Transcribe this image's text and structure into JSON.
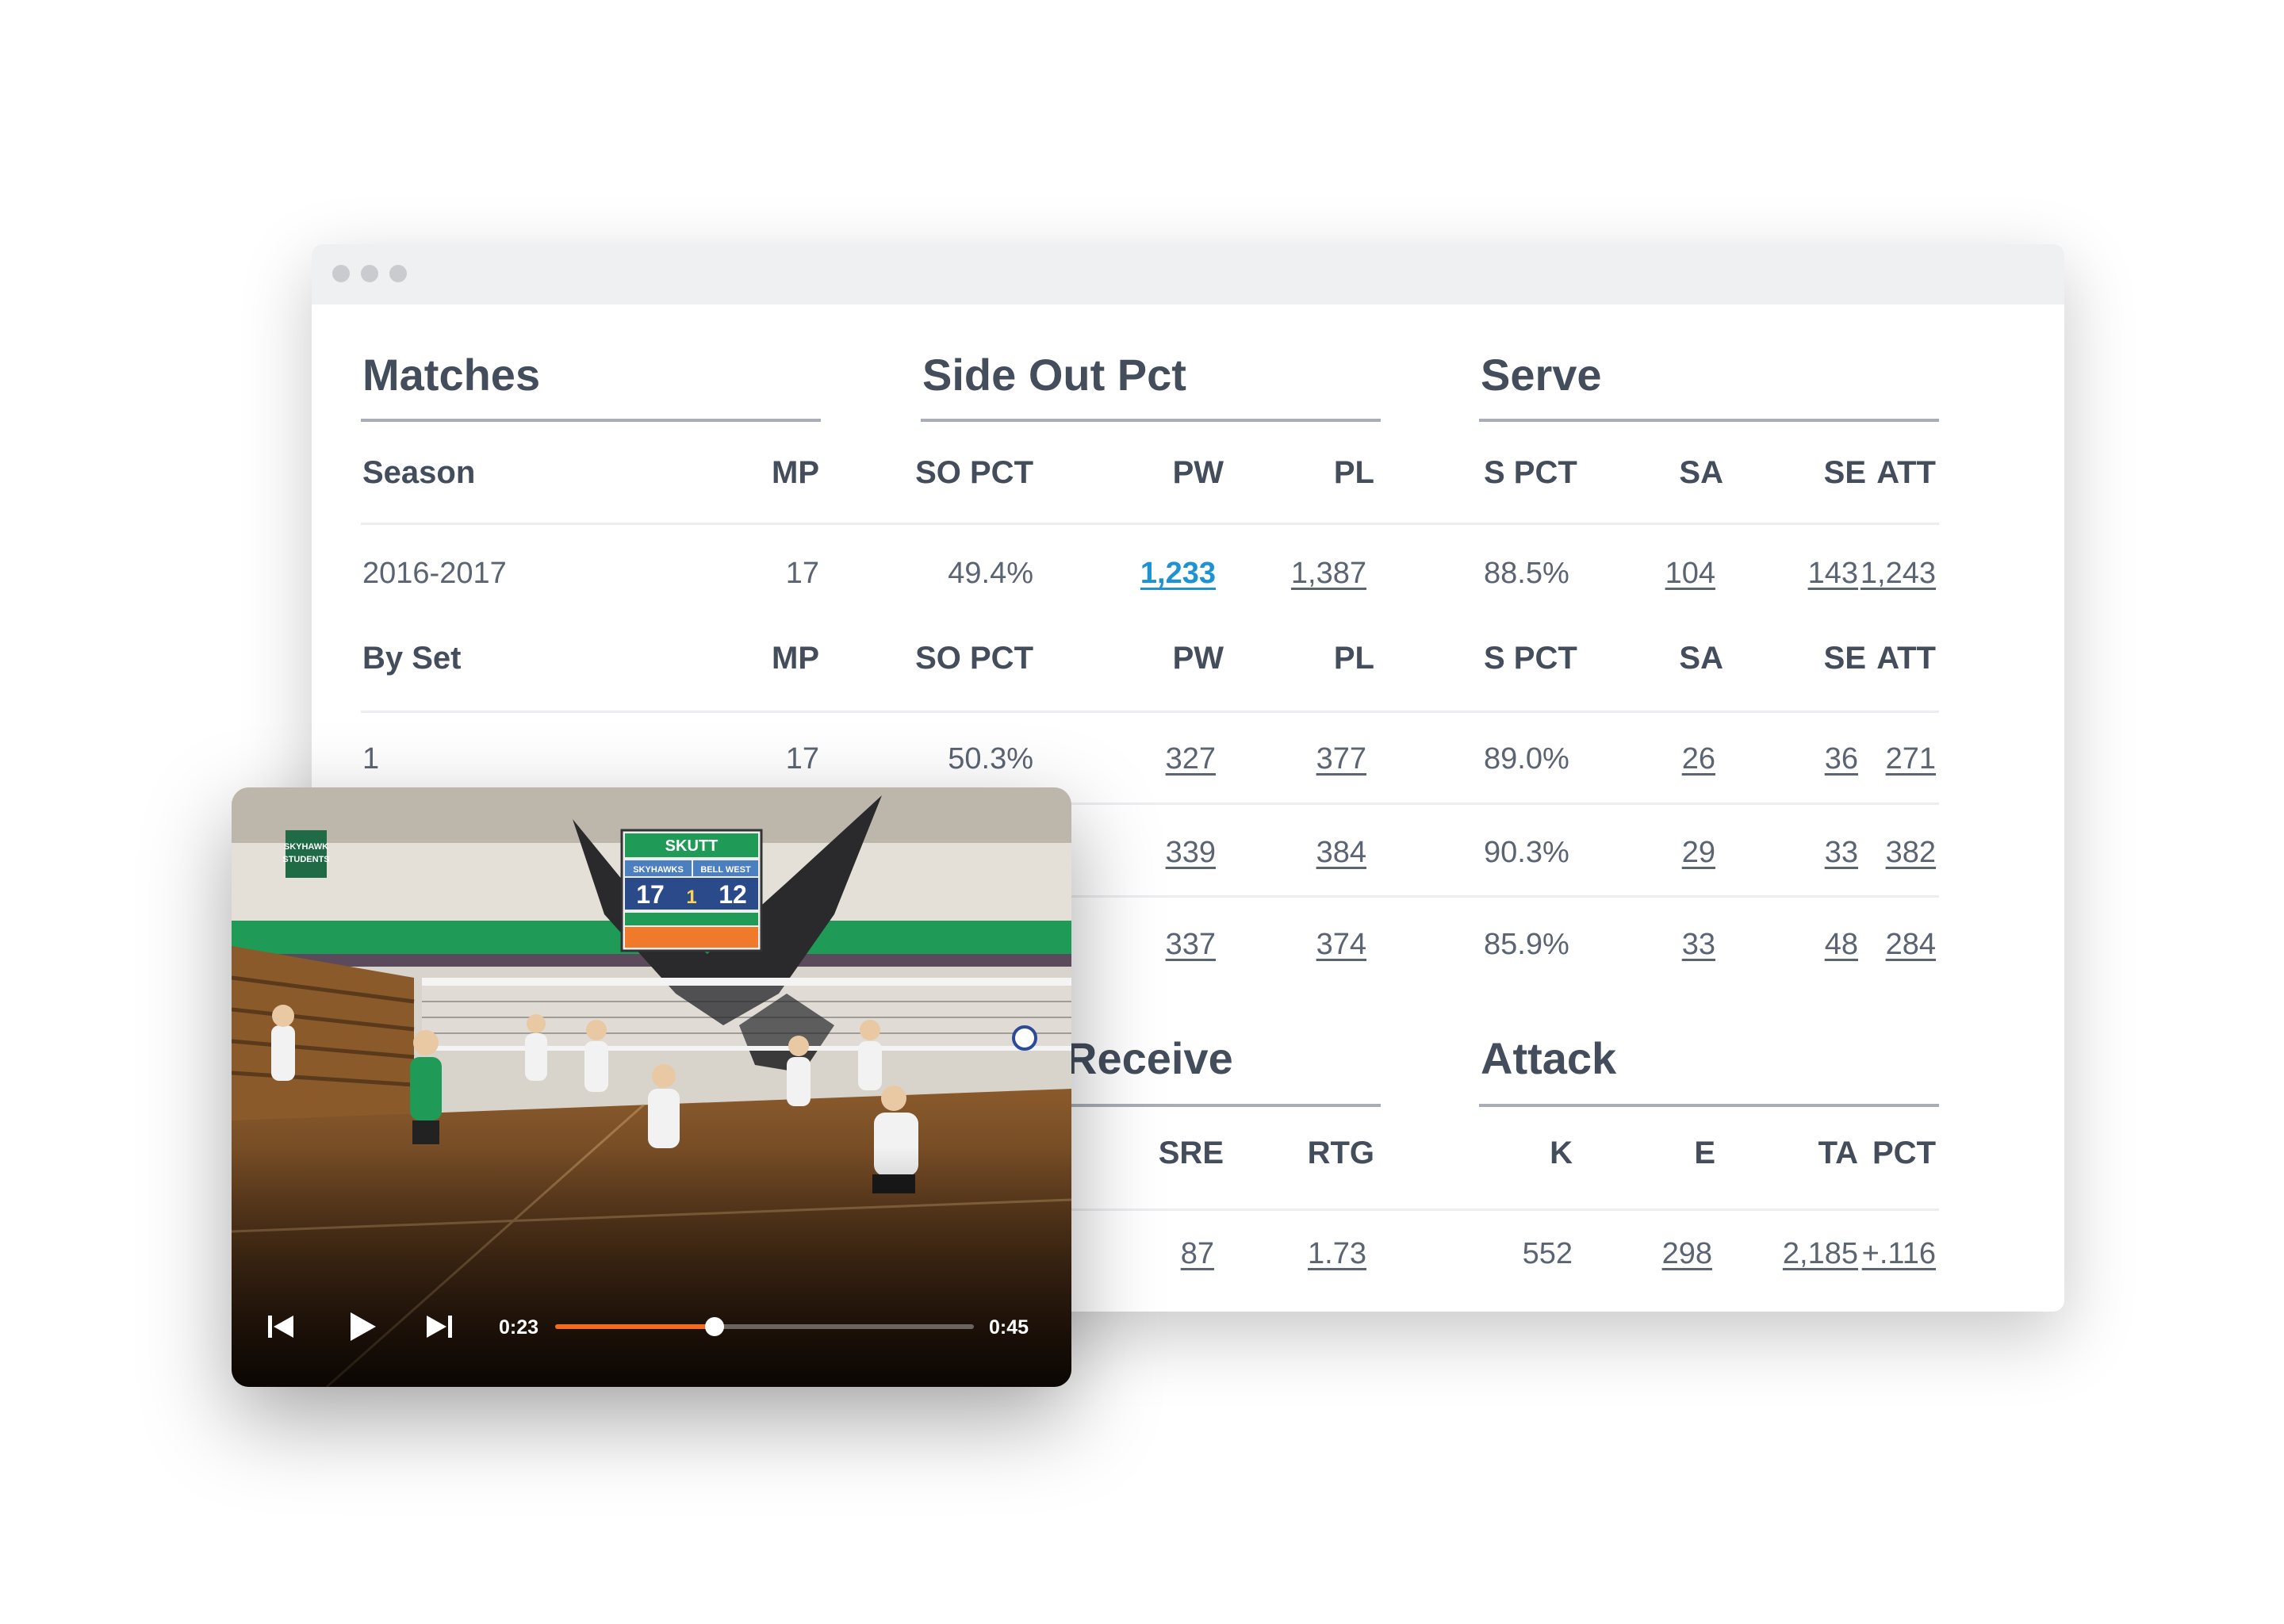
{
  "sections": {
    "matches": "Matches",
    "side_out": "Side Out Pct",
    "serve": "Serve",
    "receive": "Receive",
    "attack": "Attack"
  },
  "season_header": [
    "Season",
    "MP",
    "SO PCT",
    "PW",
    "PL",
    "S PCT",
    "SA",
    "SE",
    "ATT"
  ],
  "season_row": [
    "2016-2017",
    "17",
    "49.4%",
    "1,233",
    "1,387",
    "88.5%",
    "104",
    "143",
    "1,243"
  ],
  "set_header": [
    "By Set",
    "MP",
    "SO PCT",
    "PW",
    "PL",
    "S PCT",
    "SA",
    "SE",
    "ATT"
  ],
  "set_rows": [
    [
      "1",
      "17",
      "50.3%",
      "327",
      "377",
      "89.0%",
      "26",
      "36",
      "271"
    ],
    [
      "",
      "",
      "",
      "339",
      "384",
      "90.3%",
      "29",
      "33",
      "382"
    ],
    [
      "",
      "",
      "",
      "337",
      "374",
      "85.9%",
      "33",
      "48",
      "284"
    ]
  ],
  "bottom_header": [
    "SRE",
    "RTG",
    "K",
    "E",
    "TA",
    "PCT"
  ],
  "bottom_row": [
    "87",
    "1.73",
    "552",
    "298",
    "2,185",
    "+.116"
  ],
  "player": {
    "elapsed": "0:23",
    "total": "0:45",
    "progress": 0.38,
    "scoreboard": {
      "brand": "SKUTT",
      "home": "SKYHAWKS",
      "away": "BELL WEST",
      "home_score": "17",
      "set": "1",
      "away_score": "12"
    },
    "banner": "SKYHAWK STUDENTS"
  },
  "colors": {
    "heading": "#434d5c",
    "text": "#5b6472",
    "link_active": "#1d93d3",
    "progress": "#f36b21",
    "wall_green": "#1f9a57"
  }
}
